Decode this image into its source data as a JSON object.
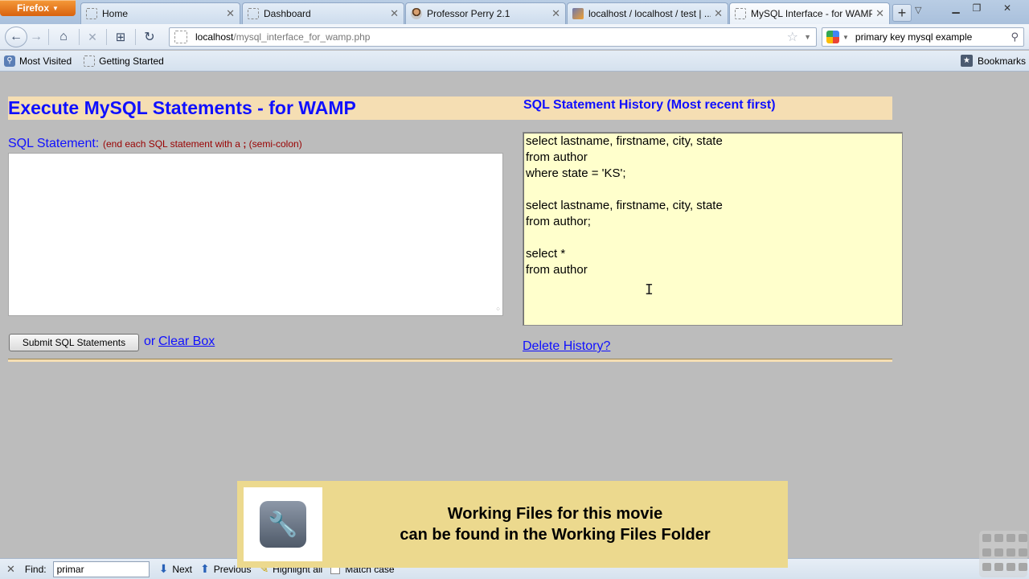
{
  "browser": {
    "menu_label": "Firefox",
    "tabs": [
      {
        "label": "Home",
        "active": false
      },
      {
        "label": "Dashboard",
        "active": false
      },
      {
        "label": "Professor Perry 2.1",
        "active": false
      },
      {
        "label": "localhost / localhost / test | ...",
        "active": false
      },
      {
        "label": "MySQL Interface - for WAMP",
        "active": true
      }
    ],
    "url_host": "localhost",
    "url_path": "/mysql_interface_for_wamp.php",
    "search_value": "primary key mysql example",
    "bookmarks_bar": [
      {
        "label": "Most Visited",
        "icon": "most-visited-icon"
      },
      {
        "label": "Getting Started",
        "icon": "page-icon"
      }
    ],
    "bookmarks_button": "Bookmarks"
  },
  "page": {
    "main_title": "Execute MySQL Statements - for WAMP",
    "history_title": "SQL Statement History (Most recent first)",
    "sql_label": "SQL Statement:",
    "sql_hint_before": "(end each SQL statement with a",
    "sql_hint_char": ";",
    "sql_hint_after": "(semi-colon)",
    "sql_value": "",
    "history_value": "select lastname, firstname, city, state\nfrom author\nwhere state = 'KS';\n\nselect lastname, firstname, city, state\nfrom author;\n\nselect *\nfrom author",
    "submit_label": "Submit SQL Statements",
    "or_text": "or",
    "clear_label": "Clear Box",
    "delete_label": "Delete History?"
  },
  "notice": {
    "line1": "Working Files for this movie",
    "line2": "can be found in the Working Files Folder"
  },
  "findbar": {
    "label": "Find:",
    "value": "primar",
    "next": "Next",
    "previous": "Previous",
    "highlight": "Highlight all",
    "match_case": "Match case"
  },
  "colors": {
    "heading_blue": "#1010ff",
    "band": "#f5deb3",
    "history_bg": "#ffffcc",
    "hint_red": "#990000"
  }
}
